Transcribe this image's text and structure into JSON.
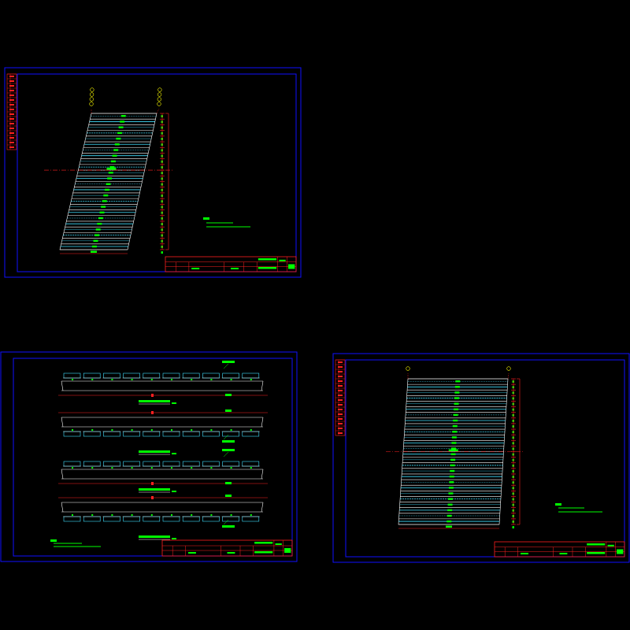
{
  "colors": {
    "background": "#000000",
    "frame": "#1010ff",
    "panel_line": "#ffffff",
    "deck": "#40e0ff",
    "annotation": "#00ff00",
    "dimension": "#ff2020",
    "axis_marker": "#ffff00"
  },
  "sheets": [
    {
      "name": "sheet-top-left",
      "kind": "skewed-plan"
    },
    {
      "name": "sheet-bottom-left",
      "kind": "section-elevations"
    },
    {
      "name": "sheet-right",
      "kind": "skewed-plan"
    }
  ],
  "icons": {
    "axis_marker": "circle-marker-icon",
    "title_block": "title-block-icon",
    "revision_strip": "revision-strip-icon"
  }
}
